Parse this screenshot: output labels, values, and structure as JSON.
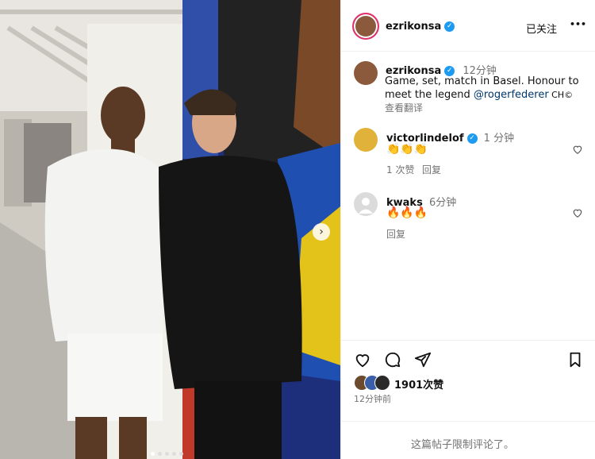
{
  "post": {
    "author": "ezrikonsa",
    "follow_label": "已关注",
    "more_label": "•••",
    "caption_author": "ezrikonsa",
    "caption_time": "12分钟",
    "caption_line1": "Game, set, match in Basel. Honour to",
    "caption_line2_prefix": "meet the legend ",
    "caption_mention": "@rogerfederer",
    "caption_suffix": " CH©",
    "translate_label": "查看翻译",
    "likes": "1901次赞",
    "time_ago": "12分钟前",
    "comments_disabled": "这篇帖子限制评论了。"
  },
  "comments": [
    {
      "user": "victorlindelof",
      "time": "1 分钟",
      "text": "👏👏👏",
      "likes": "1 次赞",
      "reply": "回复"
    },
    {
      "user": "kwaks",
      "time": "6分钟",
      "text": "🔥🔥🔥",
      "reply": "回复"
    }
  ],
  "carousel": {
    "count": 5,
    "current": 1
  },
  "icons": [
    "heart-icon",
    "comment-icon",
    "share-icon",
    "bookmark-icon",
    "next-arrow-icon",
    "verified-icon"
  ],
  "colors": {
    "verified": "#1d9bf0",
    "link": "#00376b",
    "ring": "#e1306c"
  }
}
